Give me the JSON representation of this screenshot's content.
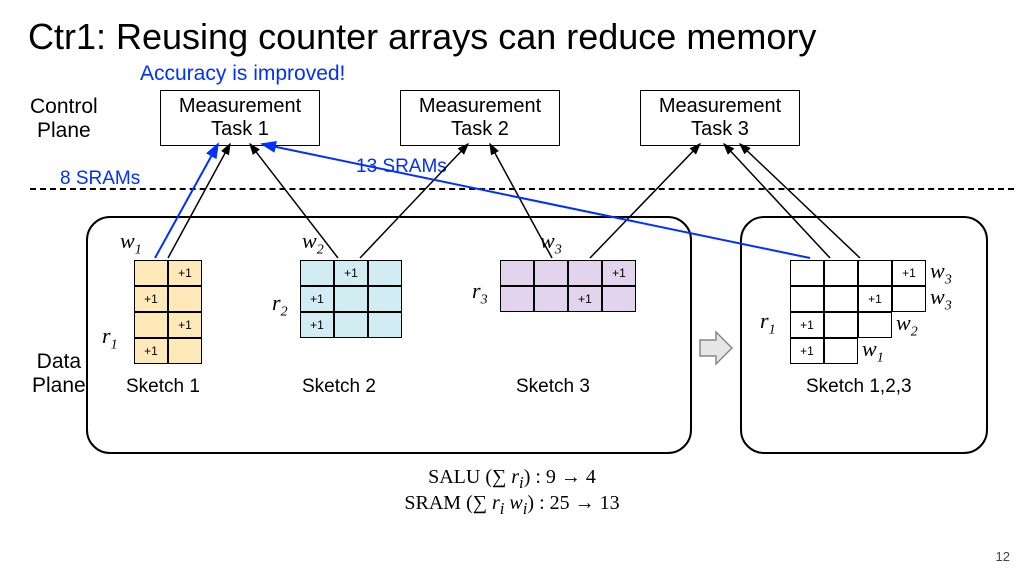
{
  "title": "Ctr1: Reusing counter arrays can reduce memory",
  "accuracy": "Accuracy is improved!",
  "labels": {
    "control": "Control\nPlane",
    "data": "Data\nPlane"
  },
  "tasks": {
    "t1": "Measurement\nTask 1",
    "t2": "Measurement\nTask 2",
    "t3": "Measurement\nTask 3"
  },
  "srams": {
    "a": "8 SRAMs",
    "b": "13 SRAMs"
  },
  "w": {
    "w1": "w",
    "w2": "w",
    "w3": "w"
  },
  "wsub": {
    "w1": "1",
    "w2": "2",
    "w3": "3"
  },
  "r": {
    "r1": "r",
    "r2": "r",
    "r3": "r"
  },
  "rsub": {
    "r1": "1",
    "r2": "2",
    "r3": "3"
  },
  "side": {
    "w3a": "w",
    "w3b": "w",
    "w2": "w",
    "w1": "w",
    "r1": "r"
  },
  "sidesub": {
    "w3a": "3",
    "w3b": "3",
    "w2": "2",
    "w1": "1",
    "r1": "1"
  },
  "sketchLabels": {
    "s1": "Sketch 1",
    "s2": "Sketch 2",
    "s3": "Sketch 3",
    "s123": "Sketch 1,2,3"
  },
  "formula": {
    "line1_pre": "SALU (∑ ",
    "line1_r": "r",
    "line1_i": "i",
    "line1_post": ") : 9 → 4",
    "line2_pre": "SRAM (∑ ",
    "line2_r": "r",
    "line2_i1": "i",
    "line2_sp": " ",
    "line2_w": "w",
    "line2_i2": "i",
    "line2_post": ") : 25 → 13"
  },
  "plus": "+1",
  "page": "12",
  "chart_data": {
    "type": "table",
    "title": "Counter array reuse: SALU and SRAM reduction",
    "sketches": [
      {
        "name": "Sketch 1",
        "r": 4,
        "w": 2,
        "color": "#ffe9b8",
        "increments": [
          [
            1,
            0
          ],
          [
            0,
            1
          ],
          [
            1,
            0
          ],
          [
            0,
            1
          ]
        ]
      },
      {
        "name": "Sketch 2",
        "r": 3,
        "w": 3,
        "color": "#d2ecf4",
        "increments": [
          [
            1,
            0,
            0
          ],
          [
            0,
            0,
            1
          ],
          [
            1,
            0,
            0
          ]
        ]
      },
      {
        "name": "Sketch 3",
        "r": 2,
        "w": 4,
        "color": "#e2d4ed",
        "increments": [
          [
            0,
            0,
            1,
            0
          ],
          [
            1,
            0,
            0,
            0
          ]
        ]
      }
    ],
    "combined_sketch": {
      "name": "Sketch 1,2,3",
      "r": 4,
      "w_per_row": [
        4,
        4,
        3,
        2
      ],
      "row_origin": [
        "w3",
        "w3",
        "w2",
        "w1"
      ],
      "increments": [
        [
          0,
          0,
          0,
          1
        ],
        [
          0,
          0,
          1,
          0
        ],
        [
          1,
          0,
          0,
          0
        ],
        [
          1,
          0,
          0,
          0
        ]
      ]
    },
    "SALU_sum_ri": {
      "before": 9,
      "after": 4
    },
    "SRAM_sum_ri_wi": {
      "before": 25,
      "after": 13
    },
    "srams_annotations": {
      "sketch1_alone": 8,
      "combined": 13
    }
  }
}
